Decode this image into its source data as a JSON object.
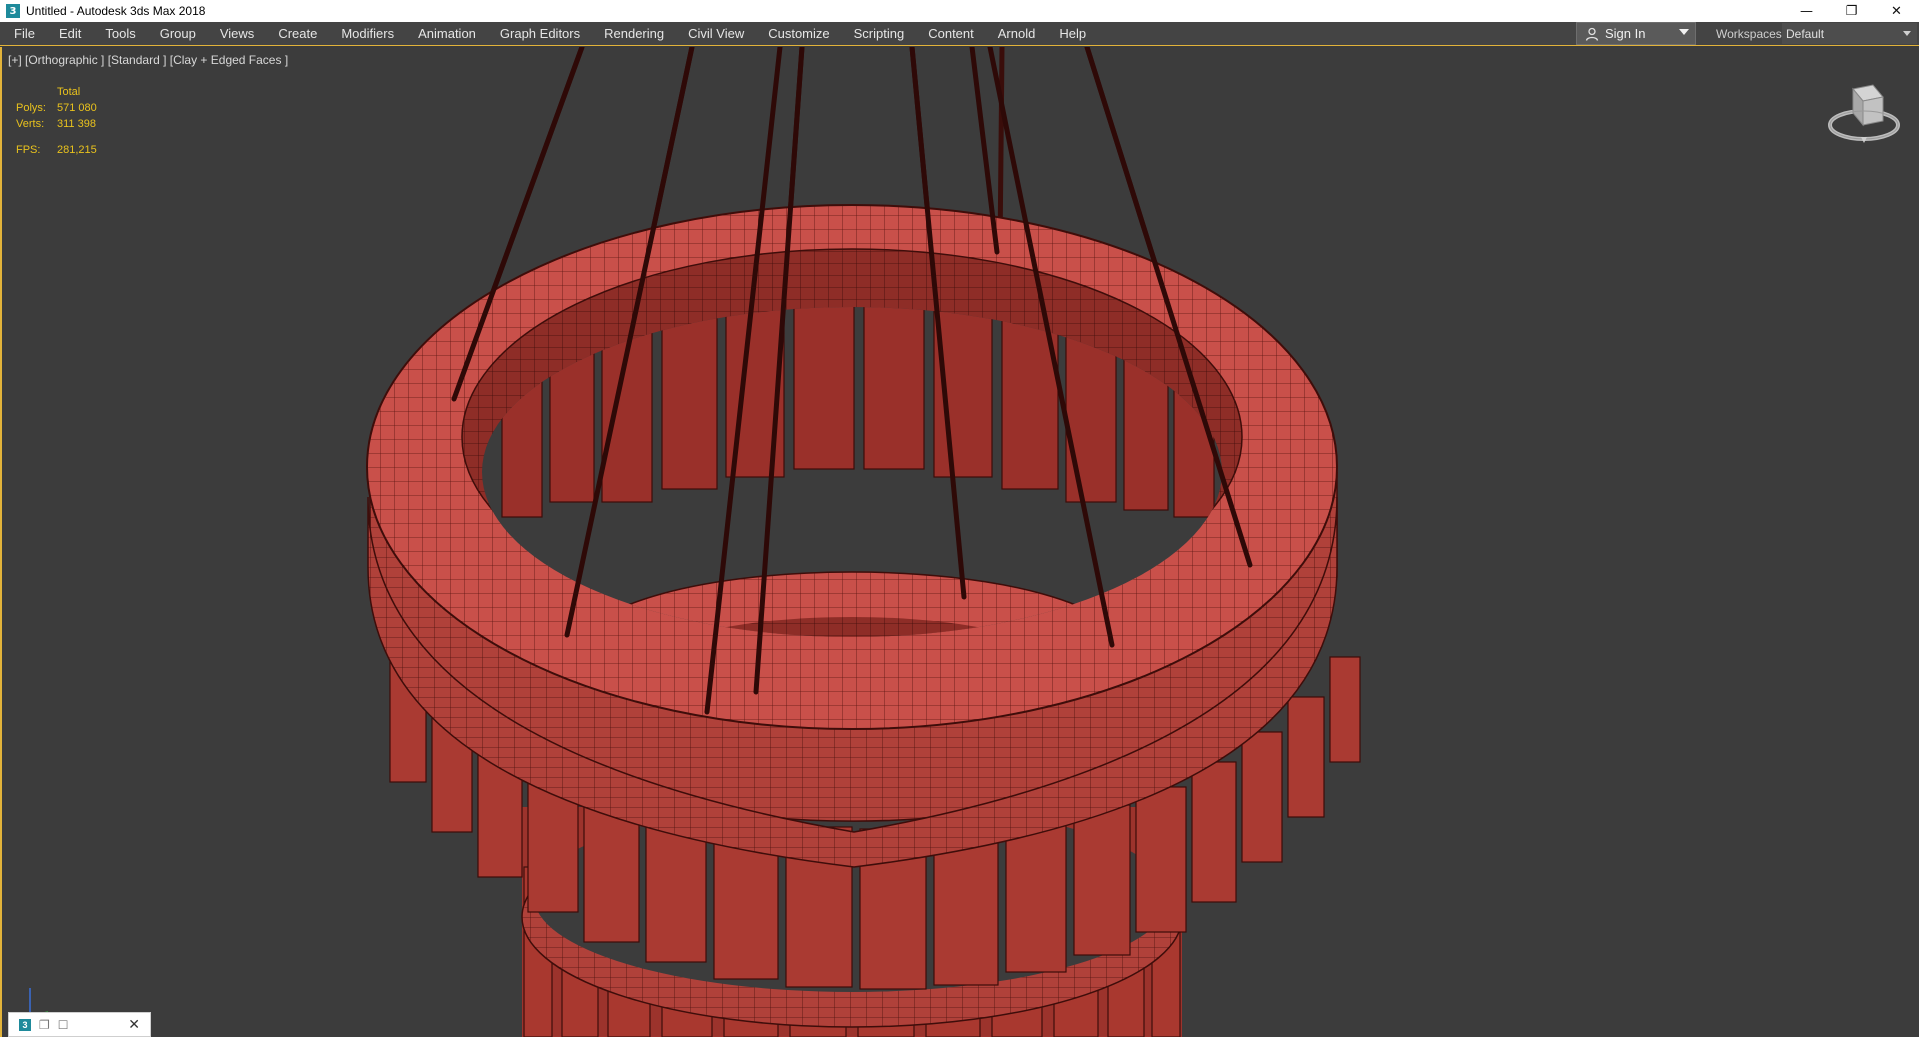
{
  "window": {
    "title": "Untitled - Autodesk 3ds Max 2018",
    "app_icon_glyph": "3",
    "controls": {
      "minimize": "—",
      "restore": "❐",
      "close": "✕"
    }
  },
  "menu": {
    "items": [
      {
        "label": "File"
      },
      {
        "label": "Edit"
      },
      {
        "label": "Tools"
      },
      {
        "label": "Group"
      },
      {
        "label": "Views"
      },
      {
        "label": "Create"
      },
      {
        "label": "Modifiers"
      },
      {
        "label": "Animation"
      },
      {
        "label": "Graph Editors"
      },
      {
        "label": "Rendering"
      },
      {
        "label": "Civil View"
      },
      {
        "label": "Customize"
      },
      {
        "label": "Scripting"
      },
      {
        "label": "Content"
      },
      {
        "label": "Arnold"
      },
      {
        "label": "Help"
      }
    ],
    "sign_in": "Sign In",
    "workspaces_label": "Workspaces:",
    "workspaces_value": "Default"
  },
  "viewport": {
    "label": "[+] [Orthographic ] [Standard ] [Clay + Edged Faces ]",
    "stats": {
      "header": "Total",
      "polys_label": "Polys:",
      "polys_value": "571 080",
      "verts_label": "Verts:",
      "verts_value": "311 398",
      "fps_label": "FPS:",
      "fps_value": "281,215"
    },
    "viewcube_icon": "viewcube-icon",
    "axis_icon": "axis-tripod-icon"
  },
  "taskbar": {
    "mini_icon_glyph": "3"
  },
  "colors": {
    "menu_bg": "#444444",
    "viewport_bg": "#3c3c3c",
    "accent": "#e2b33a",
    "stats_text": "#e9c21d",
    "clay": "#c24a40",
    "clay_dark": "#7a1e18",
    "rope": "#3a0d0a"
  }
}
